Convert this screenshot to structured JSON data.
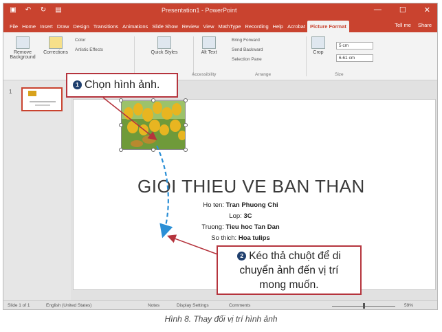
{
  "titlebar": {
    "title": "Presentation1 - PowerPoint",
    "controls": [
      "—",
      "☐",
      "✕"
    ]
  },
  "tabs": [
    "File",
    "Home",
    "Insert",
    "Draw",
    "Design",
    "Transitions",
    "Animations",
    "Slide Show",
    "Review",
    "View",
    "MathType",
    "Recording",
    "Help",
    "Acrobat",
    "Picture Format"
  ],
  "tab_tools": [
    "Tell me",
    "Share"
  ],
  "ribbon": {
    "remove_background": "Remove Background",
    "corrections": "Corrections",
    "color": "Color",
    "artistic_effects": "Artistic Effects",
    "quick_styles": "Quick Styles",
    "alt_text": "Alt Text",
    "accessibility": "Accessibility",
    "bring_forward": "Bring Forward",
    "send_backward": "Send Backward",
    "selection_pane": "Selection Pane",
    "arrange": "Arrange",
    "crop": "Crop",
    "size": "Size",
    "height": "5 cm",
    "width": "6.61 cm"
  },
  "thumbnail": {
    "number": "1"
  },
  "slide": {
    "title": "GIOI THIEU VE BAN THAN",
    "lines": [
      {
        "label": "Ho ten: ",
        "value": "Tran Phuong Chi"
      },
      {
        "label": "Lop: ",
        "value": "3C"
      },
      {
        "label": "Truong: ",
        "value": "Tieu hoc Tan Dan"
      },
      {
        "label": "So thich: ",
        "value": "Hoa tulips"
      }
    ]
  },
  "statusbar": {
    "slide_info": "Slide 1 of 1",
    "language": "English (United States)",
    "notes": "Notes",
    "display_settings": "Display Settings",
    "comments": "Comments",
    "zoom": "59%"
  },
  "callouts": {
    "step1_number": "1",
    "step1_text": "Chọn hình ảnh.",
    "step2_number": "2",
    "step2_line1": "Kéo thả chuột để di",
    "step2_line2": "chuyển ảnh đến vị trí",
    "step2_line3": "mong muốn."
  },
  "caption": "Hình 8. Thay đổi vị trí hình ảnh",
  "colors": {
    "accent": "#c9432f",
    "callout_border": "#b5343d",
    "number_badge": "#1f3f6e",
    "drag_arrow": "#2b8fd6"
  }
}
